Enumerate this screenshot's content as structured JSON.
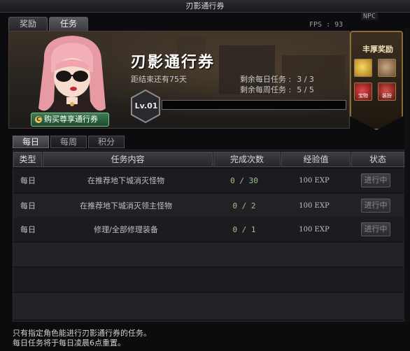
{
  "window": {
    "title": "刃影通行券"
  },
  "top_tabs": [
    {
      "label": "奖励",
      "active": false
    },
    {
      "label": "任务",
      "active": true
    }
  ],
  "hud": {
    "fps": "FPS : 93",
    "npc": "NPC"
  },
  "banner": {
    "pass_title": "刃影通行券",
    "countdown": "距结束还有75天",
    "remaining_daily_label": "剩余每日任务 :",
    "remaining_daily_value": "3 / 3",
    "remaining_weekly_label": "剩余每周任务 :",
    "remaining_weekly_value": "5 / 5",
    "level": "Lv.01",
    "xp_progress": 0,
    "buy_button": "购买尊享通行券"
  },
  "rewards": {
    "title": "丰厚奖励",
    "items": [
      {
        "name": "gold-chest-icon",
        "caption": ""
      },
      {
        "name": "cake-icon",
        "caption": ""
      },
      {
        "name": "coupon-icon",
        "caption": "宝物"
      },
      {
        "name": "ticket-icon",
        "caption": "装扮"
      }
    ]
  },
  "sub_tabs": [
    {
      "label": "每日",
      "active": true
    },
    {
      "label": "每周",
      "active": false
    },
    {
      "label": "积分",
      "active": false
    }
  ],
  "table": {
    "headers": [
      "类型",
      "任务内容",
      "完成次数",
      "经验值",
      "状态"
    ],
    "rows": [
      {
        "type": "每日",
        "task": "在推荐地下城消灭怪物",
        "count": "0 / 30",
        "exp": "100 EXP",
        "status": "进行中"
      },
      {
        "type": "每日",
        "task": "在推荐地下城消灭领主怪物",
        "count": "0 / 2",
        "exp": "100 EXP",
        "status": "进行中"
      },
      {
        "type": "每日",
        "task": "修理/全部修理装备",
        "count": "0 / 1",
        "exp": "100 EXP",
        "status": "进行中"
      }
    ]
  },
  "footer": {
    "line1": "只有指定角色能进行刃影通行券的任务。",
    "line2": "每日任务将于每日凌晨6点重置。"
  }
}
